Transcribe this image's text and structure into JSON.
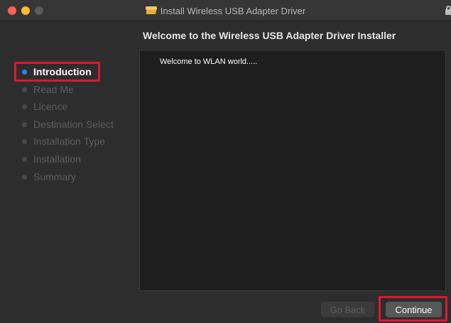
{
  "window": {
    "title": "Install Wireless USB Adapter Driver"
  },
  "pane": {
    "title": "Welcome to the Wireless USB Adapter Driver Installer",
    "body_text": "Welcome to WLAN world....."
  },
  "sidebar": {
    "steps": [
      {
        "label": "Introduction",
        "active": true
      },
      {
        "label": "Read Me",
        "active": false
      },
      {
        "label": "Licence",
        "active": false
      },
      {
        "label": "Destination Select",
        "active": false
      },
      {
        "label": "Installation Type",
        "active": false
      },
      {
        "label": "Installation",
        "active": false
      },
      {
        "label": "Summary",
        "active": false
      }
    ]
  },
  "buttons": {
    "back_label": "Go Back",
    "continue_label": "Continue"
  },
  "icons": {
    "title_icon": "package-icon",
    "lock_icon": "lock-icon"
  },
  "colors": {
    "active_step_dot": "#2f7ef2",
    "highlight_border": "#e0172f",
    "close": "#fe5f57",
    "minimize": "#febc2e"
  }
}
